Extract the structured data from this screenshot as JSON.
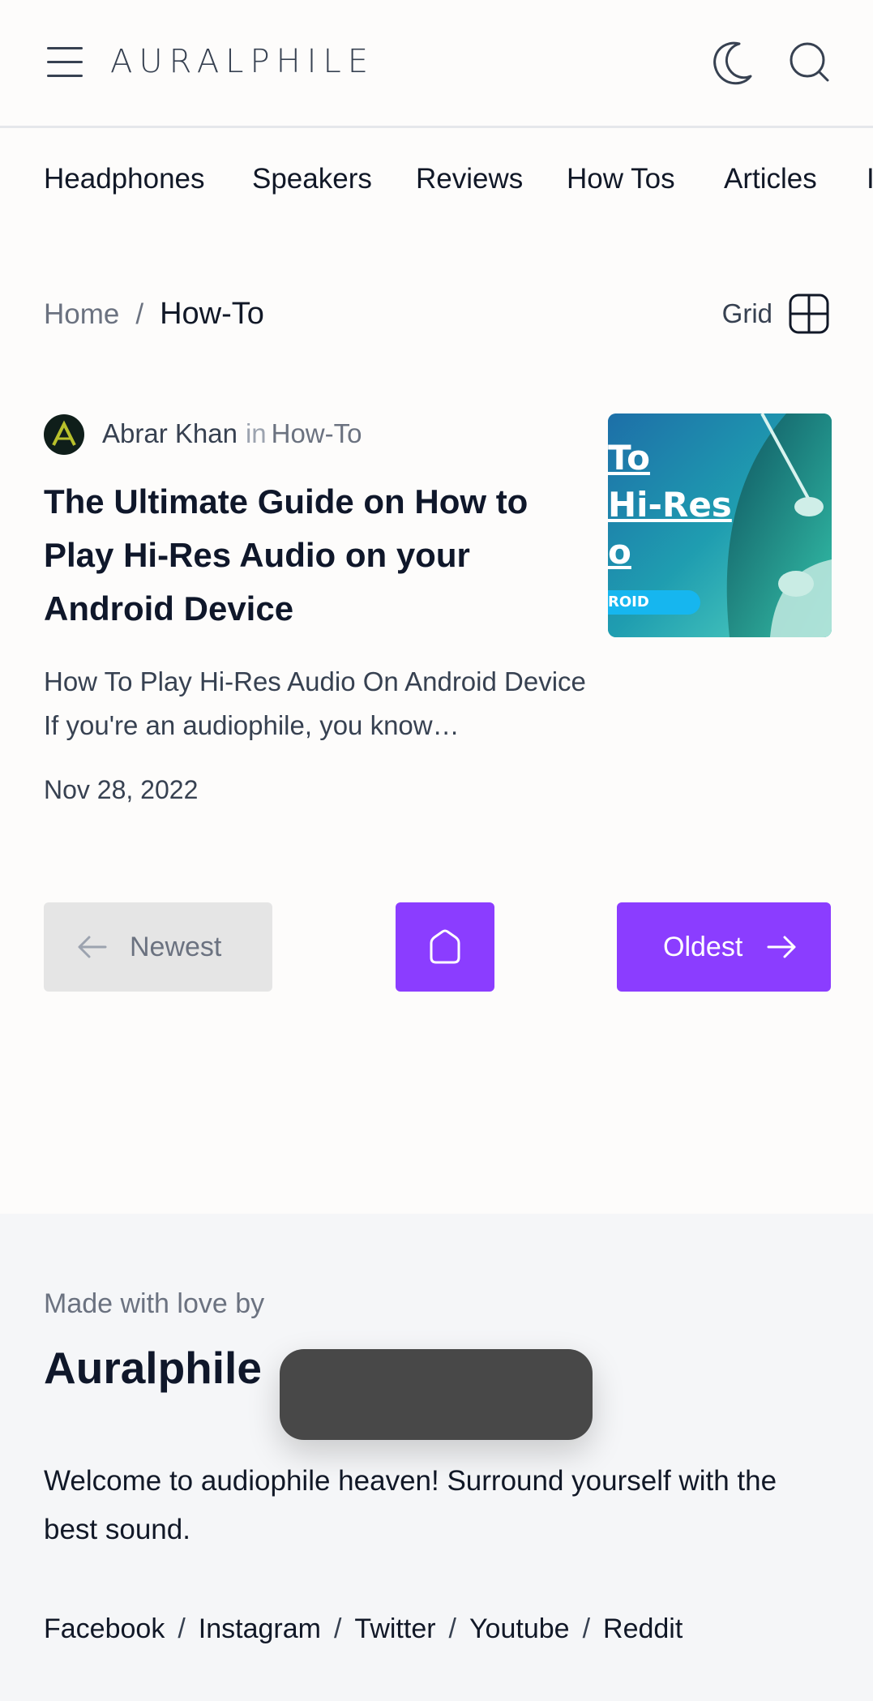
{
  "header": {
    "logo": "AURALPHILE",
    "icons": {
      "menu": "hamburger-icon",
      "theme": "moon-icon",
      "search": "search-icon"
    }
  },
  "nav": {
    "items": [
      {
        "label": "Headphones"
      },
      {
        "label": "Speakers"
      },
      {
        "label": "Reviews"
      },
      {
        "label": "How Tos"
      },
      {
        "label": "Articles"
      },
      {
        "label": "I"
      }
    ]
  },
  "breadcrumb": {
    "home": "Home",
    "separator": "/",
    "current": "How-To",
    "view_label": "Grid",
    "view_icon": "grid-icon"
  },
  "post": {
    "author": "Abrar Khan",
    "in_word": "in",
    "category": "How-To",
    "title": "The Ultimate Guide on How to Play Hi-Res Audio on your Android Device",
    "excerpt": "How To Play Hi-Res Audio On Android Device If you're an audiophile, you know…",
    "date": "Nov 28, 2022",
    "thumb_lines": [
      "To",
      "Hi-Res",
      "o"
    ],
    "thumb_badge": "ROID"
  },
  "pagination": {
    "prev_label": "Newest",
    "next_label": "Oldest",
    "home_icon": "home-icon"
  },
  "footer": {
    "made_by": "Made with love by",
    "brand": "Auralphile",
    "tagline": "Welcome to audiophile heaven! Surround yourself with the best sound.",
    "social": [
      "Facebook",
      "Instagram",
      "Twitter",
      "Youtube",
      "Reddit"
    ],
    "separator": "/"
  },
  "colors": {
    "accent": "#8b3dff",
    "background": "#fdfcfb",
    "footer_bg": "#f5f6f8",
    "toast_bg": "#484848"
  }
}
